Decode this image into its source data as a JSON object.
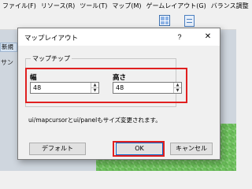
{
  "app": {
    "menu": [
      "ファイル(F)",
      "リソース(R)",
      "ツール(T)",
      "マップ(M)",
      "ゲームレイアウト(G)",
      "バランス調整"
    ],
    "left_panel_tab": "新規",
    "left_panel_text": "サン"
  },
  "dialog": {
    "title": "マップレイアウト",
    "help_glyph": "?",
    "close_glyph": "✕",
    "group_label": "マップチップ",
    "width_label": "幅",
    "width_value": "48",
    "height_label": "高さ",
    "height_value": "48",
    "note": "ui/mapcursorとui/panelもサイズ変更されます。",
    "buttons": {
      "default": "デフォルト",
      "ok": "OK",
      "cancel": "キャンセル"
    }
  },
  "colors": {
    "highlight": "#e02020",
    "accent": "#0a64c8"
  },
  "icons": [
    "grid-view-icon",
    "sheet-icon",
    "spin-up-icon",
    "spin-down-icon"
  ]
}
